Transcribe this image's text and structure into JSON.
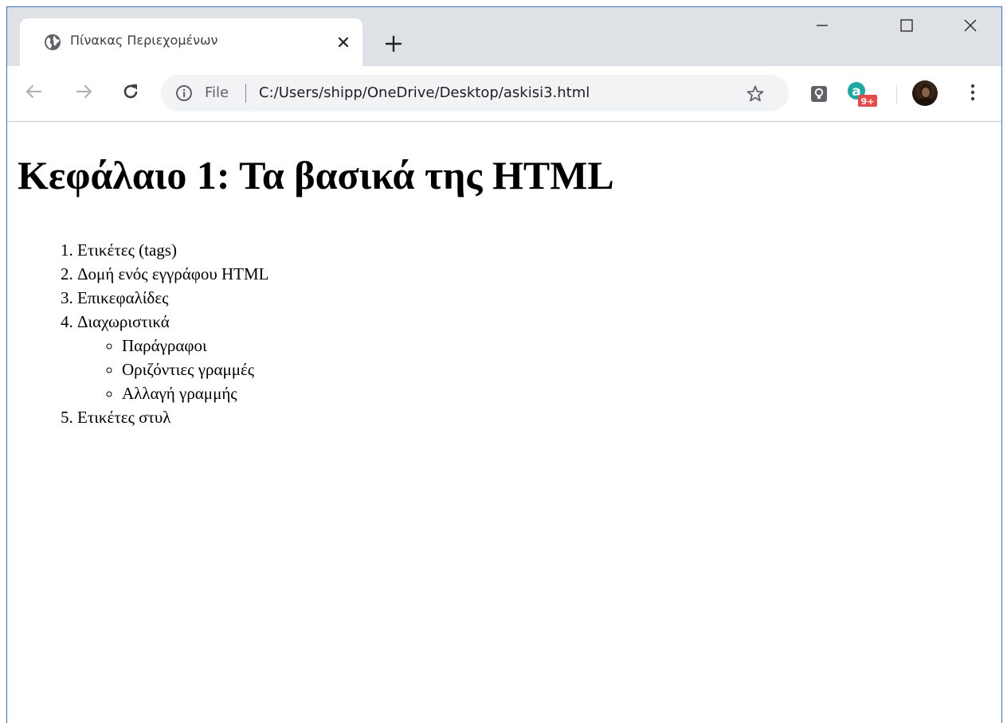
{
  "browser": {
    "tab": {
      "title": "Πίνακας Περιεχομένων"
    },
    "address": {
      "scheme_label": "File",
      "url": "C:/Users/shipp/OneDrive/Desktop/askisi3.html"
    },
    "extensions": {
      "adblock_badge": "9+"
    },
    "icons": {
      "tab_favicon": "globe-icon",
      "tab_close": "close-icon",
      "new_tab": "plus-icon",
      "back": "arrow-left-icon",
      "forward": "arrow-right-icon",
      "reload": "reload-icon",
      "info": "info-icon",
      "bookmark": "star-icon",
      "menu": "kebab-icon"
    }
  },
  "page": {
    "heading": "Κεφάλαιο 1: Τα βασικά της HTML",
    "items": [
      {
        "label": "Ετικέτες (tags)"
      },
      {
        "label": "Δομή ενός εγγράφου HTML"
      },
      {
        "label": "Επικεφαλίδες"
      },
      {
        "label": "Διαχωριστικά",
        "subitems": [
          "Παράγραφοι",
          "Οριζόντιες γραμμές",
          "Αλλαγή γραμμής"
        ]
      },
      {
        "label": "Ετικέτες στυλ"
      }
    ]
  }
}
